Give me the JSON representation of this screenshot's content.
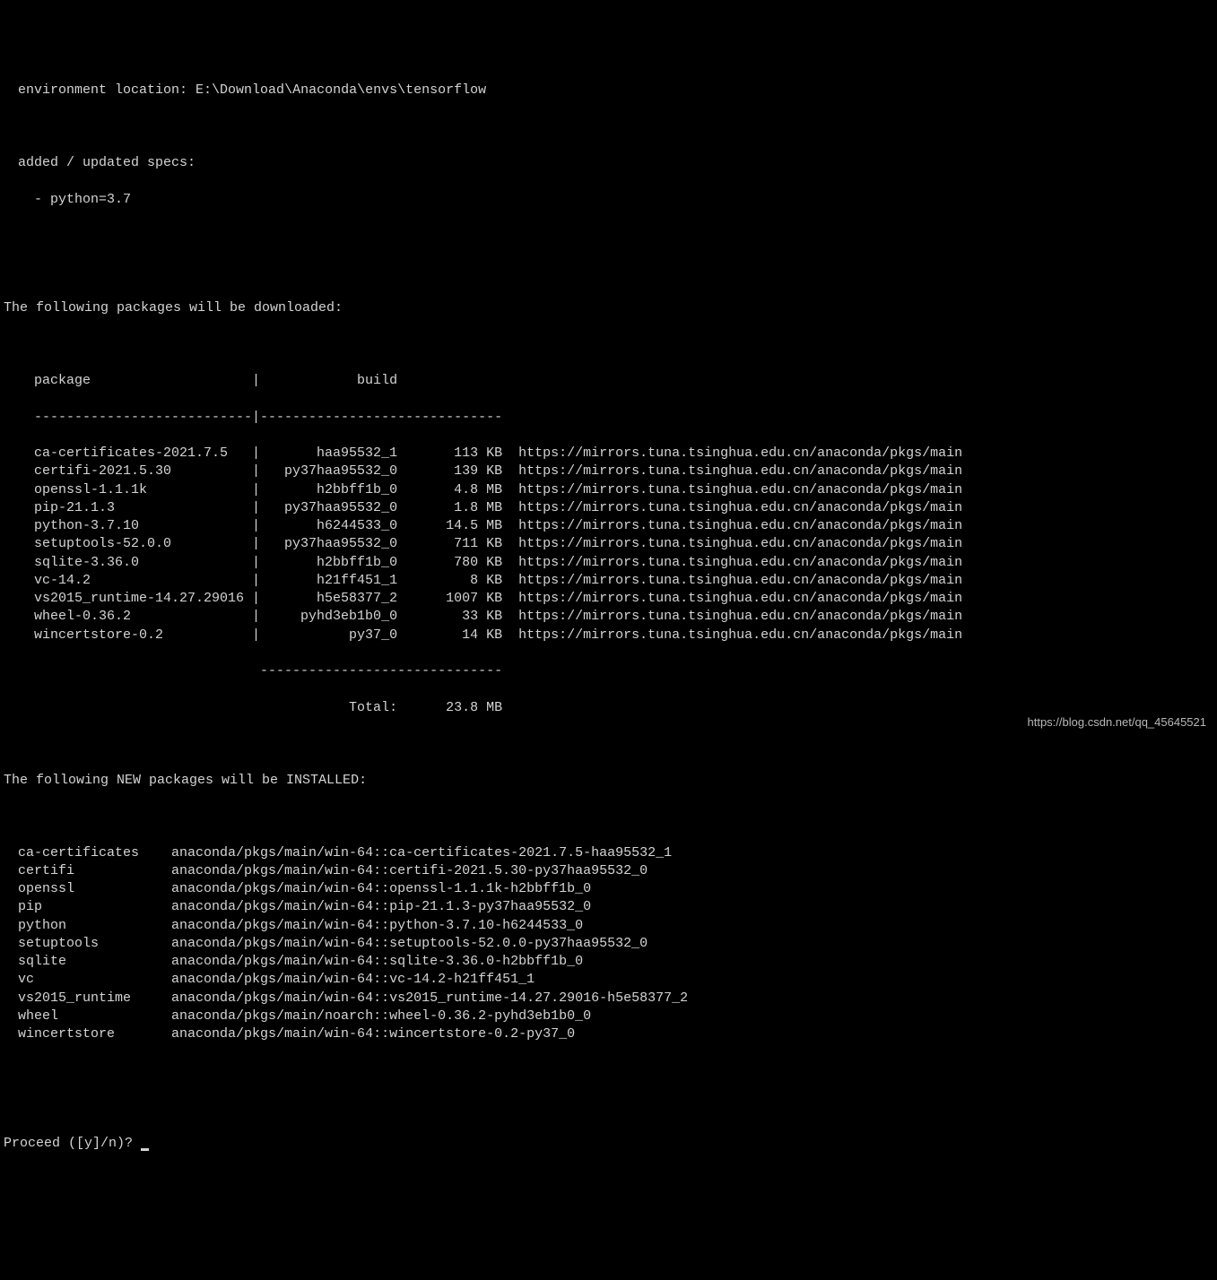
{
  "header": {
    "env_label": "environment location:",
    "env_path": "E:\\Download\\Anaconda\\envs\\tensorflow",
    "specs_label": "added / updated specs:",
    "specs_item": "- python=3.7"
  },
  "downloads": {
    "title": "The following packages will be downloaded:",
    "col_package": "package",
    "col_build": "build",
    "rows": [
      {
        "package": "ca-certificates-2021.7.5",
        "build": "haa95532_1",
        "size": "113 KB",
        "url": "https://mirrors.tuna.tsinghua.edu.cn/anaconda/pkgs/main"
      },
      {
        "package": "certifi-2021.5.30",
        "build": "py37haa95532_0",
        "size": "139 KB",
        "url": "https://mirrors.tuna.tsinghua.edu.cn/anaconda/pkgs/main"
      },
      {
        "package": "openssl-1.1.1k",
        "build": "h2bbff1b_0",
        "size": "4.8 MB",
        "url": "https://mirrors.tuna.tsinghua.edu.cn/anaconda/pkgs/main"
      },
      {
        "package": "pip-21.1.3",
        "build": "py37haa95532_0",
        "size": "1.8 MB",
        "url": "https://mirrors.tuna.tsinghua.edu.cn/anaconda/pkgs/main"
      },
      {
        "package": "python-3.7.10",
        "build": "h6244533_0",
        "size": "14.5 MB",
        "url": "https://mirrors.tuna.tsinghua.edu.cn/anaconda/pkgs/main"
      },
      {
        "package": "setuptools-52.0.0",
        "build": "py37haa95532_0",
        "size": "711 KB",
        "url": "https://mirrors.tuna.tsinghua.edu.cn/anaconda/pkgs/main"
      },
      {
        "package": "sqlite-3.36.0",
        "build": "h2bbff1b_0",
        "size": "780 KB",
        "url": "https://mirrors.tuna.tsinghua.edu.cn/anaconda/pkgs/main"
      },
      {
        "package": "vc-14.2",
        "build": "h21ff451_1",
        "size": "8 KB",
        "url": "https://mirrors.tuna.tsinghua.edu.cn/anaconda/pkgs/main"
      },
      {
        "package": "vs2015_runtime-14.27.29016",
        "build": "h5e58377_2",
        "size": "1007 KB",
        "url": "https://mirrors.tuna.tsinghua.edu.cn/anaconda/pkgs/main"
      },
      {
        "package": "wheel-0.36.2",
        "build": "pyhd3eb1b0_0",
        "size": "33 KB",
        "url": "https://mirrors.tuna.tsinghua.edu.cn/anaconda/pkgs/main"
      },
      {
        "package": "wincertstore-0.2",
        "build": "py37_0",
        "size": "14 KB",
        "url": "https://mirrors.tuna.tsinghua.edu.cn/anaconda/pkgs/main"
      }
    ],
    "total_label": "Total:",
    "total_size": "23.8 MB"
  },
  "installs": {
    "title": "The following NEW packages will be INSTALLED:",
    "rows": [
      {
        "name": "ca-certificates",
        "spec": "anaconda/pkgs/main/win-64::ca-certificates-2021.7.5-haa95532_1"
      },
      {
        "name": "certifi",
        "spec": "anaconda/pkgs/main/win-64::certifi-2021.5.30-py37haa95532_0"
      },
      {
        "name": "openssl",
        "spec": "anaconda/pkgs/main/win-64::openssl-1.1.1k-h2bbff1b_0"
      },
      {
        "name": "pip",
        "spec": "anaconda/pkgs/main/win-64::pip-21.1.3-py37haa95532_0"
      },
      {
        "name": "python",
        "spec": "anaconda/pkgs/main/win-64::python-3.7.10-h6244533_0"
      },
      {
        "name": "setuptools",
        "spec": "anaconda/pkgs/main/win-64::setuptools-52.0.0-py37haa95532_0"
      },
      {
        "name": "sqlite",
        "spec": "anaconda/pkgs/main/win-64::sqlite-3.36.0-h2bbff1b_0"
      },
      {
        "name": "vc",
        "spec": "anaconda/pkgs/main/win-64::vc-14.2-h21ff451_1"
      },
      {
        "name": "vs2015_runtime",
        "spec": "anaconda/pkgs/main/win-64::vs2015_runtime-14.27.29016-h5e58377_2"
      },
      {
        "name": "wheel",
        "spec": "anaconda/pkgs/main/noarch::wheel-0.36.2-pyhd3eb1b0_0"
      },
      {
        "name": "wincertstore",
        "spec": "anaconda/pkgs/main/win-64::wincertstore-0.2-py37_0"
      }
    ]
  },
  "prompt": {
    "text": "Proceed ([y]/n)? "
  },
  "watermark": "https://blog.csdn.net/qq_45645521"
}
